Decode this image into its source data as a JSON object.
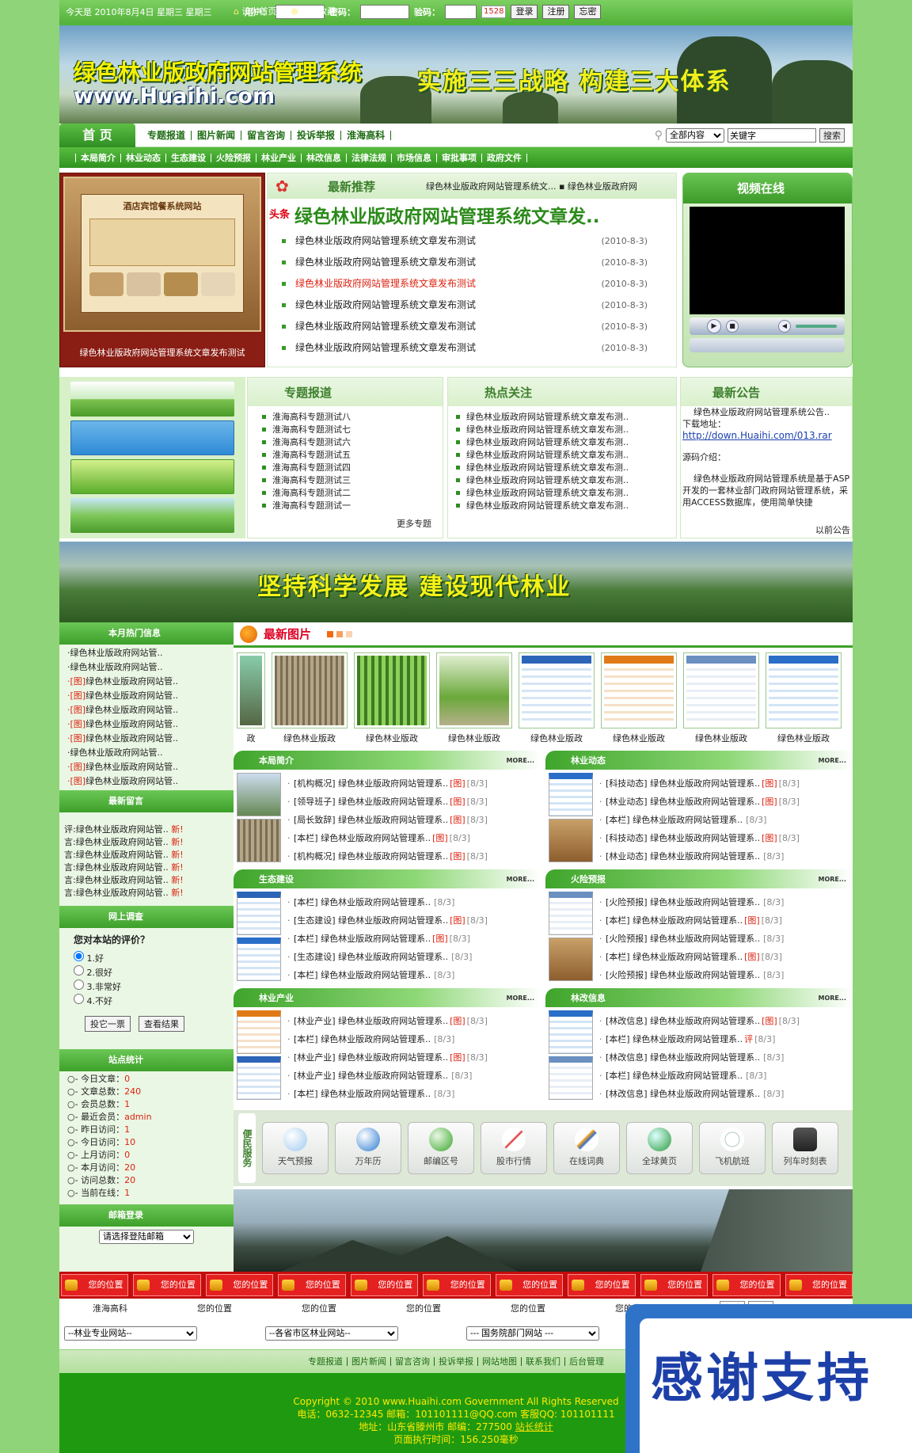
{
  "topbar": {
    "date": "今天是 2010年8月4日 星期三 星期三",
    "user_label": "用户：",
    "pwd_label": "密码：",
    "code_label": "验码：",
    "captcha": "1528",
    "login": "登录",
    "register": "注册",
    "forgot": "忘密",
    "set_home": "设为首页",
    "add_fav": "加入收藏"
  },
  "banner": {
    "title": "绿色林业版政府网站管理系统",
    "url": "www.Huaihi.com",
    "slogan": "实施三三战略  构建三大体系"
  },
  "nav1": {
    "home": "首 页",
    "items": [
      "专题报道",
      "图片新闻",
      "留言咨询",
      "投诉举报",
      "淮海高科"
    ],
    "search_select": "全部内容",
    "search_input": "关键字",
    "search_btn": "搜索"
  },
  "nav2": [
    "本局简介",
    "林业动态",
    "生态建设",
    "火险预报",
    "林业产业",
    "林改信息",
    "法律法规",
    "市场信息",
    "审批事项",
    "政府文件"
  ],
  "featured": {
    "caption": "绿色林业版政府网站管理系统文章发布测试",
    "pic_title": "酒店宾馆餐系统网站"
  },
  "latest": {
    "title": "最新推荐",
    "marquee": "绿色林业版政府网站管理系统文...  ▪ 绿色林业版政府网",
    "head_tag": "头条",
    "headline": "绿色林业版政府网站管理系统文章发..",
    "items": [
      {
        "t": "绿色林业版政府网站管理系统文章发布测试",
        "d": "(2010-8-3)"
      },
      {
        "t": "绿色林业版政府网站管理系统文章发布测试",
        "d": "(2010-8-3)"
      },
      {
        "t": "绿色林业版政府网站管理系统文章发布测试",
        "d": "(2010-8-3)"
      },
      {
        "t": "绿色林业版政府网站管理系统文章发布测试",
        "d": "(2010-8-3)"
      },
      {
        "t": "绿色林业版政府网站管理系统文章发布测试",
        "d": "(2010-8-3)"
      },
      {
        "t": "绿色林业版政府网站管理系统文章发布测试",
        "d": "(2010-8-3)"
      }
    ]
  },
  "video": {
    "title": "视频在线"
  },
  "topics": {
    "title": "专题报道",
    "items": [
      "淮海高科专题测试八",
      "淮海高科专题测试七",
      "淮海高科专题测试六",
      "淮海高科专题测试五",
      "淮海高科专题测试四",
      "淮海高科专题测试三",
      "淮海高科专题测试二",
      "淮海高科专题测试一"
    ],
    "more": "更多专题"
  },
  "hot": {
    "title": "热点关注",
    "items": [
      "绿色林业版政府网站管理系统文章发布测..",
      "绿色林业版政府网站管理系统文章发布测..",
      "绿色林业版政府网站管理系统文章发布测..",
      "绿色林业版政府网站管理系统文章发布测..",
      "绿色林业版政府网站管理系统文章发布测..",
      "绿色林业版政府网站管理系统文章发布测..",
      "绿色林业版政府网站管理系统文章发布测..",
      "绿色林业版政府网站管理系统文章发布测.."
    ]
  },
  "notice": {
    "title": "最新公告",
    "p1": "绿色林业版政府网站管理系统公告..",
    "dl": "下载地址：",
    "link": "http://down.Huaihi.com/013.rar",
    "intro": "源码介绍：",
    "p2": "绿色林业版政府网站管理系统是基于ASP开发的一套林业部门政府网站管理系统，采用ACCESS数据库，使用简单快捷",
    "more": "以前公告"
  },
  "slogan2": "坚持科学发展  建设现代林业",
  "left": {
    "hot_title": "本月热门信息",
    "hot_items": [
      {
        "tag": "",
        "t": "·绿色林业版政府网站管.."
      },
      {
        "tag": "",
        "t": "·绿色林业版政府网站管.."
      },
      {
        "tag": "·[图]",
        "t": "绿色林业版政府网站管.."
      },
      {
        "tag": "·[图]",
        "t": "绿色林业版政府网站管.."
      },
      {
        "tag": "·[图]",
        "t": "绿色林业版政府网站管.."
      },
      {
        "tag": "·[图]",
        "t": "绿色林业版政府网站管.."
      },
      {
        "tag": "·[图]",
        "t": "绿色林业版政府网站管.."
      },
      {
        "tag": "",
        "t": "·绿色林业版政府网站管.."
      },
      {
        "tag": "·[图]",
        "t": "绿色林业版政府网站管.."
      },
      {
        "tag": "·[图]",
        "t": "绿色林业版政府网站管.."
      }
    ],
    "msg_title": "最新留言",
    "msg_items": [
      {
        "t": "评:绿色林业版政府网站管..",
        "n": "新!"
      },
      {
        "t": "言:绿色林业版政府网站管..",
        "n": "新!"
      },
      {
        "t": "言:绿色林业版政府网站管..",
        "n": "新!"
      },
      {
        "t": "言:绿色林业版政府网站管..",
        "n": "新!"
      },
      {
        "t": "言:绿色林业版政府网站管..",
        "n": "新!"
      },
      {
        "t": "言:绿色林业版政府网站管..",
        "n": "新!"
      }
    ],
    "survey_title": "网上调查",
    "survey_q": "您对本站的评价？",
    "survey_opts": [
      "1.好",
      "2.很好",
      "3.非常好",
      "4.不好"
    ],
    "vote": "投它一票",
    "result": "查看结果",
    "stats_title": "站点统计",
    "stats": [
      {
        "k": "○- 今日文章：",
        "v": "0"
      },
      {
        "k": "○- 文章总数：",
        "v": "240"
      },
      {
        "k": "○- 会员总数：",
        "v": "1"
      },
      {
        "k": "○- 最近会员：",
        "v": "admin"
      },
      {
        "k": "○- 昨日访问：",
        "v": "1"
      },
      {
        "k": "○- 今日访问：",
        "v": "10"
      },
      {
        "k": "○- 上月访问：",
        "v": "0"
      },
      {
        "k": "○- 本月访问：",
        "v": "20"
      },
      {
        "k": "○- 访问总数：",
        "v": "20"
      },
      {
        "k": "○- 当前在线：",
        "v": "1"
      }
    ],
    "mail_title": "邮箱登录",
    "mail_select": "请选择登陆邮箱"
  },
  "gallery": {
    "title": "最新图片",
    "items": [
      "政",
      "绿色林业版政",
      "绿色林业版政",
      "绿色林业版政",
      "绿色林业版政",
      "绿色林业版政",
      "绿色林业版政",
      "绿色林业版政"
    ]
  },
  "more_label": "MORE...",
  "columns": [
    {
      "title": "本局简介",
      "items": [
        {
          "c": "[机构概况] 绿色林业版政府网站管理系..",
          "g": "[图]",
          "d": "[8/3]"
        },
        {
          "c": "[领导班子] 绿色林业版政府网站管理系..",
          "g": "[图]",
          "d": "[8/3]"
        },
        {
          "c": "[局长致辞] 绿色林业版政府网站管理系..",
          "g": "[图]",
          "d": "[8/3]"
        },
        {
          "c": "[本栏] 绿色林业版政府网站管理系..",
          "g": "[图]",
          "d": "[8/3]"
        },
        {
          "c": "[机构概况] 绿色林业版政府网站管理系..",
          "g": "[图]",
          "d": "[8/3]"
        }
      ]
    },
    {
      "title": "林业动态",
      "items": [
        {
          "c": "[科技动态] 绿色林业版政府网站管理系..",
          "g": "[图]",
          "d": "[8/3]"
        },
        {
          "c": "[林业动态] 绿色林业版政府网站管理系..",
          "g": "[图]",
          "d": "[8/3]"
        },
        {
          "c": "[本栏] 绿色林业版政府网站管理系..",
          "g": "",
          "d": "[8/3]"
        },
        {
          "c": "[科技动态] 绿色林业版政府网站管理系..",
          "g": "[图]",
          "d": "[8/3]"
        },
        {
          "c": "[林业动态] 绿色林业版政府网站管理系..",
          "g": "",
          "d": "[8/3]"
        }
      ]
    },
    {
      "title": "生态建设",
      "items": [
        {
          "c": "[本栏] 绿色林业版政府网站管理系..",
          "g": "",
          "d": "[8/3]"
        },
        {
          "c": "[生态建设] 绿色林业版政府网站管理系..",
          "g": "[图]",
          "d": "[8/3]"
        },
        {
          "c": "[本栏] 绿色林业版政府网站管理系..",
          "g": "[图]",
          "d": "[8/3]"
        },
        {
          "c": "[生态建设] 绿色林业版政府网站管理系..",
          "g": "",
          "d": "[8/3]"
        },
        {
          "c": "[本栏] 绿色林业版政府网站管理系..",
          "g": "",
          "d": "[8/3]"
        }
      ]
    },
    {
      "title": "火险预报",
      "items": [
        {
          "c": "[火险预报] 绿色林业版政府网站管理系..",
          "g": "",
          "d": "[8/3]"
        },
        {
          "c": "[本栏] 绿色林业版政府网站管理系..",
          "g": "[图]",
          "d": "[8/3]"
        },
        {
          "c": "[火险预报] 绿色林业版政府网站管理系..",
          "g": "",
          "d": "[8/3]"
        },
        {
          "c": "[本栏] 绿色林业版政府网站管理系..",
          "g": "[图]",
          "d": "[8/3]"
        },
        {
          "c": "[火险预报] 绿色林业版政府网站管理系..",
          "g": "",
          "d": "[8/3]"
        }
      ]
    },
    {
      "title": "林业产业",
      "items": [
        {
          "c": "[林业产业] 绿色林业版政府网站管理系..",
          "g": "[图]",
          "d": "[8/3]"
        },
        {
          "c": "[本栏] 绿色林业版政府网站管理系..",
          "g": "",
          "d": "[8/3]"
        },
        {
          "c": "[林业产业] 绿色林业版政府网站管理系..",
          "g": "[图]",
          "d": "[8/3]"
        },
        {
          "c": "[林业产业] 绿色林业版政府网站管理系..",
          "g": "",
          "d": "[8/3]"
        },
        {
          "c": "[本栏] 绿色林业版政府网站管理系..",
          "g": "",
          "d": "[8/3]"
        }
      ]
    },
    {
      "title": "林改信息",
      "items": [
        {
          "c": "[林改信息] 绿色林业版政府网站管理系..",
          "g": "[图]",
          "d": "[8/3]"
        },
        {
          "c": "[本栏] 绿色林业版政府网站管理系..",
          "g": "评",
          "d": "[8/3]"
        },
        {
          "c": "[林改信息] 绿色林业版政府网站管理系..",
          "g": "",
          "d": "[8/3]"
        },
        {
          "c": "[本栏] 绿色林业版政府网站管理系..",
          "g": "",
          "d": "[8/3]"
        },
        {
          "c": "[林改信息] 绿色林业版政府网站管理系..",
          "g": "",
          "d": "[8/3]"
        }
      ]
    }
  ],
  "services": {
    "tag": "便民服务",
    "items": [
      "天气预报",
      "万年历",
      "邮编区号",
      "股市行情",
      "在线词典",
      "全球黄页",
      "飞机航班",
      "列车时刻表"
    ]
  },
  "locations": {
    "label": "您的位置",
    "row": [
      "淮海高科",
      "您的位置",
      "您的位置",
      "您的位置",
      "您的位置",
      "您的位置"
    ],
    "apply": "申请",
    "more": "更多"
  },
  "links": [
    "--林业专业网站--",
    "--各省市区林业网站--",
    "--- 国务院部门网站 ---"
  ],
  "bottom_nav": [
    "专题报道",
    "图片新闻",
    "留言咨询",
    "投诉举报",
    "网站地图",
    "联系我们",
    "后台管理"
  ],
  "footer": {
    "l1": "Copyright © 2010 www.Huaihi.com Government All Rights Reserved",
    "l2": "电话：0632-12345 邮箱：101101111@QQ.com 客服QQ: 101101111",
    "l3a": "地址：山东省滕州市 邮编：277500 ",
    "l3b": "站长统计",
    "l4": "页面执行时间：156.250毫秒"
  },
  "overlay": "感谢支持"
}
